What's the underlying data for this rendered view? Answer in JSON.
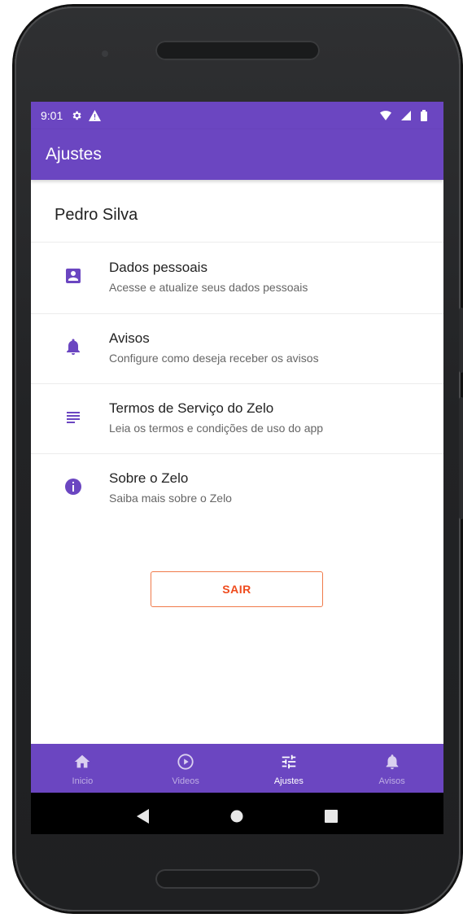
{
  "status_bar": {
    "time": "9:01"
  },
  "app_bar": {
    "title": "Ajustes"
  },
  "profile": {
    "name": "Pedro Silva"
  },
  "menu": [
    {
      "icon": "account-box-icon",
      "title": "Dados pessoais",
      "subtitle": "Acesse e atualize seus dados pessoais"
    },
    {
      "icon": "bell-icon",
      "title": "Avisos",
      "subtitle": "Configure como deseja receber os avisos"
    },
    {
      "icon": "notes-icon",
      "title": "Termos de Serviço do Zelo",
      "subtitle": "Leia os termos e condições de uso do app"
    },
    {
      "icon": "info-icon",
      "title": "Sobre o Zelo",
      "subtitle": "Saiba mais sobre o Zelo"
    }
  ],
  "logout_label": "SAIR",
  "bottom_nav": [
    {
      "icon": "home-icon",
      "label": "Inicio",
      "active": false
    },
    {
      "icon": "play-circle-icon",
      "label": "Videos",
      "active": false
    },
    {
      "icon": "tune-icon",
      "label": "Ajustes",
      "active": true
    },
    {
      "icon": "bell-icon",
      "label": "Avisos",
      "active": false
    }
  ],
  "colors": {
    "primary": "#6b46c1",
    "logout_text": "#ef4b1d",
    "logout_border": "#f07a4a"
  }
}
